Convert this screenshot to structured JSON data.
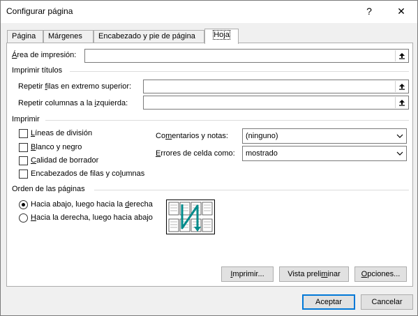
{
  "window": {
    "title": "Configurar página",
    "help_glyph": "?",
    "close_glyph": "✕"
  },
  "tabs": [
    {
      "label": "Página"
    },
    {
      "label": "Márgenes"
    },
    {
      "label": "Encabezado y pie de página"
    },
    {
      "label": "Hoja"
    }
  ],
  "print_area": {
    "label_pre": "",
    "label_u": "Á",
    "label_post": "rea de impresión:",
    "value": ""
  },
  "print_titles": {
    "section": "Imprimir títulos",
    "rows": {
      "label_pre": "Repetir ",
      "label_u": "f",
      "label_post": "ilas en extremo superior:",
      "value": ""
    },
    "cols": {
      "label_pre": "Repetir columnas a la ",
      "label_u": "i",
      "label_post": "zquierda:",
      "value": ""
    }
  },
  "print": {
    "section": "Imprimir",
    "gridlines": {
      "u": "L",
      "rest": "íneas de división",
      "checked": false
    },
    "bw": {
      "u": "B",
      "rest": "lanco y negro",
      "checked": false
    },
    "draft": {
      "u": "C",
      "rest": "alidad de borrador",
      "checked": false
    },
    "headings": {
      "pre": "Encabezados de filas y co",
      "u": "l",
      "post": "umnas",
      "checked": false
    },
    "comments": {
      "pre": "Co",
      "u": "m",
      "post": "entarios y notas:",
      "value": "(ninguno)"
    },
    "errors": {
      "pre": "",
      "u": "E",
      "post": "rrores de celda como:",
      "value": "mostrado"
    }
  },
  "page_order": {
    "section": "Orden de las páginas",
    "down_then_over": {
      "pre": "Hacia abajo, luego hacia la ",
      "u": "d",
      "post": "erecha",
      "selected": true
    },
    "over_then_down": {
      "pre": "",
      "u": "H",
      "post": "acia la derecha, luego hacia abajo",
      "selected": false
    }
  },
  "buttons": {
    "print": {
      "u": "I",
      "post": "mprimir..."
    },
    "preview": {
      "pre": "Vista preli",
      "u": "m",
      "post": "inar"
    },
    "options": {
      "u": "O",
      "post": "pciones..."
    },
    "ok": "Aceptar",
    "cancel": "Cancelar"
  },
  "icons": {
    "collapse": "collapse-dialog-icon",
    "dropdown": "chevron-down-icon",
    "order": "page-order-diagram-icon"
  },
  "colors": {
    "accent": "#0078d7",
    "arrow": "#008b8b"
  }
}
